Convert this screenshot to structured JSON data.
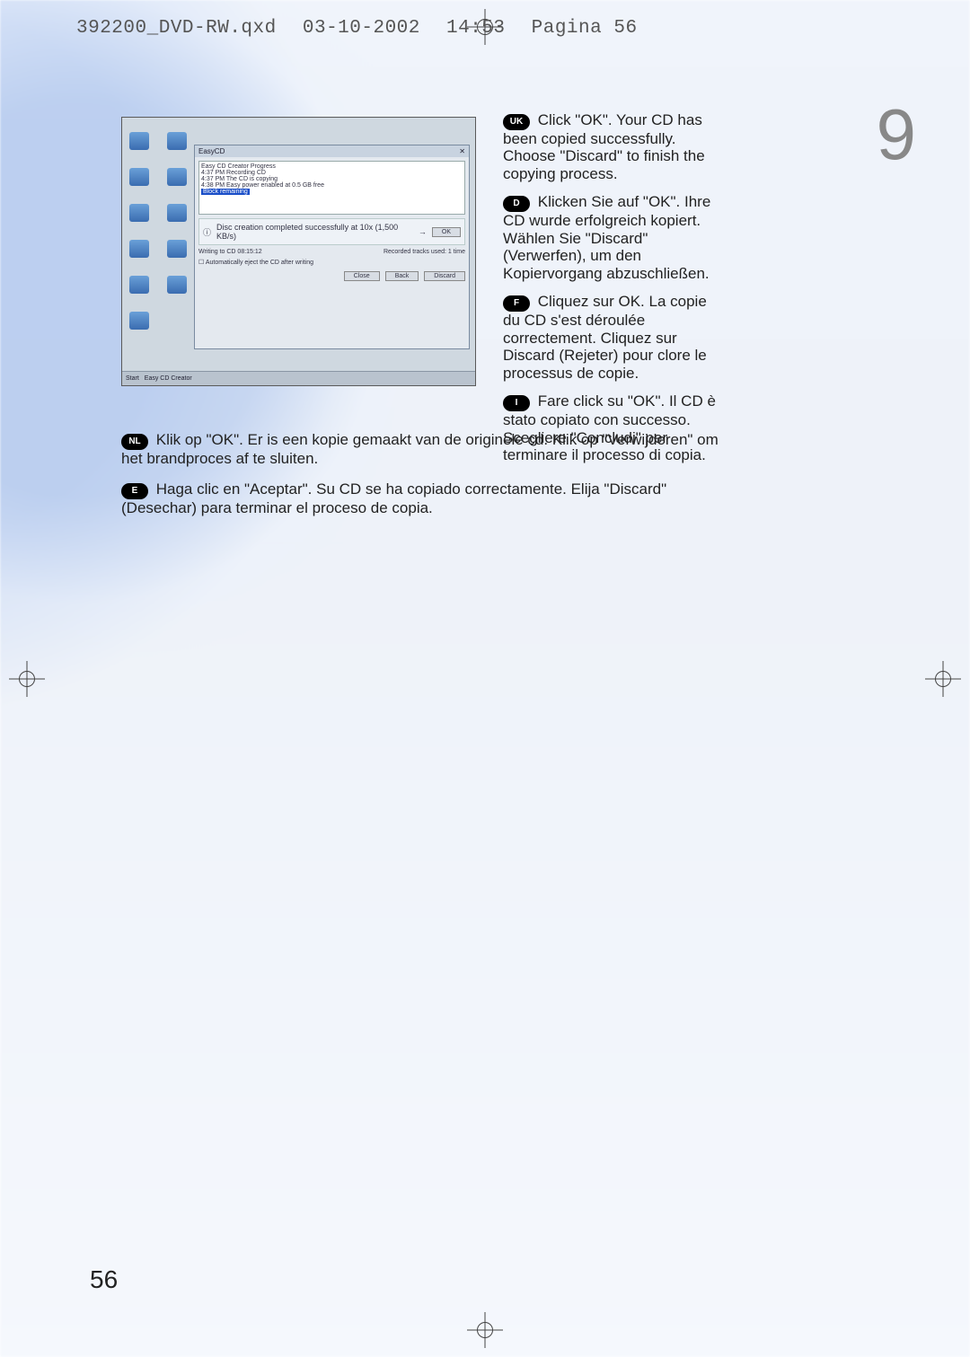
{
  "header": {
    "filename": "392200_DVD-RW.qxd",
    "date": "03-10-2002",
    "time": "14:53",
    "page_label": "Pagina 56"
  },
  "step_number": "9",
  "page_number": "56",
  "screenshot": {
    "window_title": "EasyCD",
    "list_lines": [
      "Easy CD Creator Progress",
      "4:37 PM  Recording CD",
      "4:37 PM  The CD is copying",
      "4:38 PM  Easy power enabled at 0.5 GB free",
      "Block remaining"
    ],
    "selected_line": "Block remaining",
    "progress_text": "Disc creation completed successfully at 10x (1,500 KB/s)",
    "ok_button": "OK",
    "bottom_status_left": "Writing to CD 08:15:12",
    "bottom_status_right": "Recorded tracks used: 1 time",
    "checkbox_label": "Automatically eject the CD after writing",
    "btn_close": "Close",
    "btn_back": "Back",
    "btn_discard": "Discard",
    "taskbar_start": "Start",
    "taskbar_app": "Easy CD Creator"
  },
  "instructions": {
    "uk": "Click \"OK\". Your CD has been copied successfully. Choose \"Discard\" to finish the copying process.",
    "d": "Klicken Sie auf \"OK\". Ihre CD wurde erfolgreich kopiert. Wählen Sie \"Discard\" (Verwerfen), um den Kopiervorgang abzuschließen.",
    "f": "Cliquez sur OK. La copie du CD s'est déroulée correctement. Cliquez sur Discard (Rejeter) pour clore le processus de copie.",
    "i": "Fare click su \"OK\". Il CD è stato copiato con successo. Scegliere \"Concludi\" per terminare il processo di copia.",
    "nl": "Klik op \"OK\". Er is een kopie gemaakt van de originele cd. Klik op \"Verwijderen\" om het brandproces af te sluiten.",
    "e": "Haga clic en \"Aceptar\". Su CD se ha copiado correctamente. Elija \"Discard\" (Desechar) para terminar el proceso de copia."
  },
  "badges": {
    "uk": "UK",
    "d": "D",
    "f": "F",
    "i": "I",
    "nl": "NL",
    "e": "E"
  }
}
